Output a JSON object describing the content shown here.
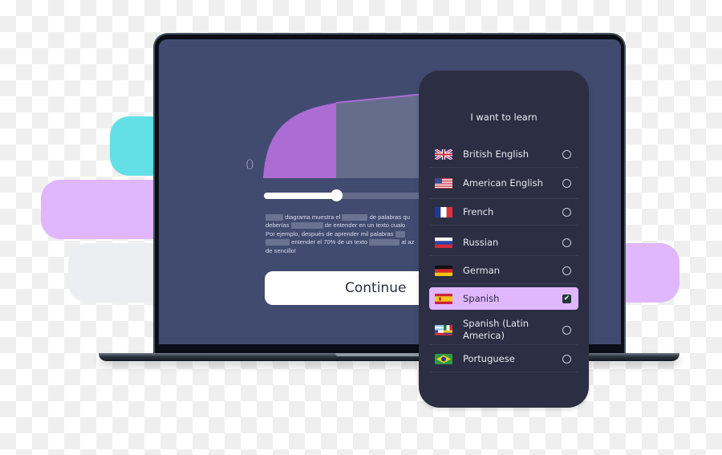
{
  "background": {
    "blobs": [
      {
        "name": "teal",
        "color": "#63e0e6"
      },
      {
        "name": "lilac",
        "color": "#e0b6fd"
      },
      {
        "name": "grey",
        "color": "#eceef1"
      }
    ]
  },
  "laptop": {
    "screen_color": "#414b70",
    "chart": {
      "zero_label": "0",
      "fill_color": "#ad6cd3",
      "rest_color": "#666d8c",
      "highlighted_fraction": 0.45
    },
    "slider": {
      "value_percent": 45
    },
    "description": {
      "lines": [
        [
          "",
          "diagrama muestra el",
          "",
          "de palabras qu"
        ],
        [
          "deberías",
          "",
          "de entender en un texto cualo"
        ],
        [
          "Por ejemplo, después de aprender mil palabras",
          ""
        ],
        [
          "",
          "entender el 70% de un texto",
          "",
          "al az"
        ],
        [
          "de sencillo!"
        ]
      ]
    },
    "continue_button": "Continue"
  },
  "phone": {
    "title": "I want to learn",
    "accent_color": "#e0b6fd",
    "languages": [
      {
        "label": "British English",
        "flag": "uk-flag",
        "selected": false
      },
      {
        "label": "American English",
        "flag": "us-flag",
        "selected": false
      },
      {
        "label": "French",
        "flag": "france-flag",
        "selected": false
      },
      {
        "label": "Russian",
        "flag": "russia-flag",
        "selected": false
      },
      {
        "label": "German",
        "flag": "germany-flag",
        "selected": false
      },
      {
        "label": "Spanish",
        "flag": "spain-flag",
        "selected": true
      },
      {
        "label": "Spanish (Latin America)",
        "flag": "latin-america-flag",
        "selected": false
      },
      {
        "label": "Portuguese",
        "flag": "brazil-flag",
        "selected": false
      }
    ],
    "check_glyph": "✔"
  }
}
